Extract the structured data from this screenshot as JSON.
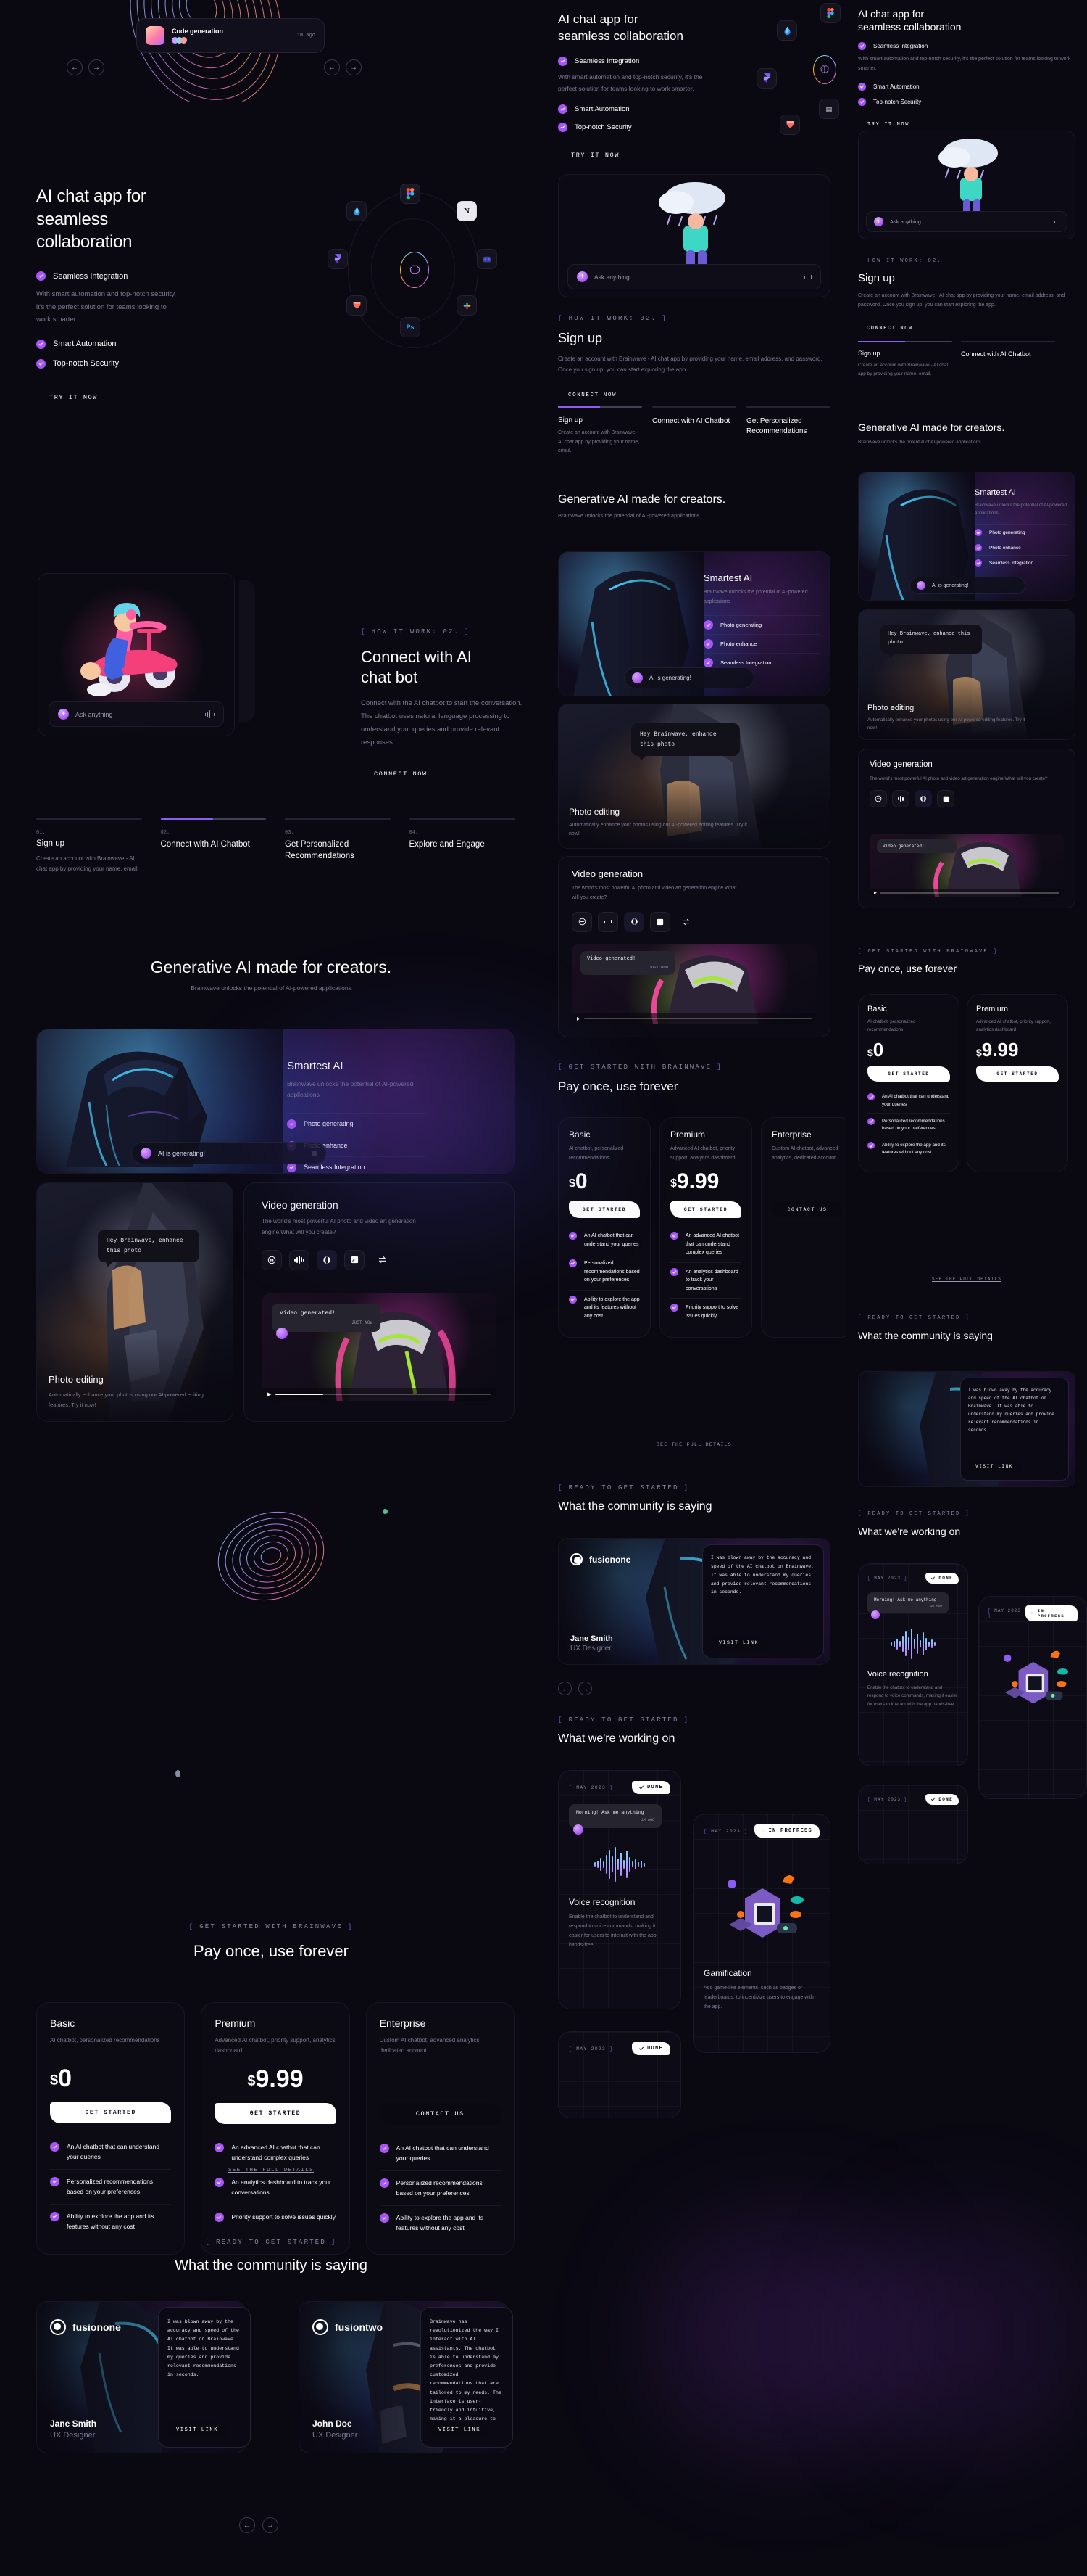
{
  "brand": {
    "name": "Brainwave"
  },
  "hero": {
    "title": "AI chat app for seamless collaboration",
    "title_line1": "AI chat app for",
    "title_line2": "seamless",
    "title_line3": "collaboration",
    "description": "With smart automation and top-notch security, it's the perfect solution for teams looking to work smarter.",
    "features": [
      "Seamless Integration",
      "Smart Automation",
      "Top-notch Security"
    ],
    "cta": "TRY IT NOW",
    "notification": {
      "title": "Code generation",
      "time": "1m ago"
    },
    "integration_icons": [
      "figma-icon",
      "notion-icon",
      "photoshop-icon",
      "slack-icon",
      "discord-icon",
      "framer-icon",
      "protopie-icon",
      "raindrop-icon",
      "brain-icon"
    ]
  },
  "howitwork": {
    "label": "HOW IT WORK: 02.",
    "title_line1": "Connect with AI",
    "title_line2": "chat bot",
    "description": "Connect with the AI chatbot to start the conversation. The chatbot uses natural language processing to understand your queries and provide relevant responses.",
    "cta": "CONNECT NOW",
    "chat_placeholder": "Ask anything"
  },
  "steps": [
    {
      "num": "01.",
      "label": "Sign up",
      "desc": "Create an account with Brainwave - AI chat app by providing your name, email.",
      "progress": 0
    },
    {
      "num": "02.",
      "label": "Connect with AI Chatbot",
      "desc": "",
      "progress": 50
    },
    {
      "num": "03.",
      "label": "Get Personalized Recommendations",
      "desc": "",
      "progress": 0
    },
    {
      "num": "04.",
      "label": "Explore and Engage",
      "desc": "",
      "progress": 0
    }
  ],
  "signup": {
    "title": "Sign up",
    "description": "Create an account with Brainwave - AI chat app by providing your name, email address, and password. Once you sign up, you can start exploring the app.",
    "cta": "CONNECT NOW"
  },
  "generative": {
    "title": "Generative AI made for creators.",
    "subtitle": "Brainwave unlocks the potential of AI-powered applications"
  },
  "smartest": {
    "title": "Smartest AI",
    "description": "Brainwave unlocks the potential of AI-powered applications",
    "features": [
      "Photo generating",
      "Photo enhance",
      "Seamless Integration"
    ],
    "status": "AI is generating!"
  },
  "photo_editing": {
    "title": "Photo editing",
    "description": "Automatically enhance your photos using our AI-powered editing features. Try it now!",
    "bubble": "Hey Brainwave, enhance this photo"
  },
  "video_generation": {
    "title": "Video generation",
    "description": "The world's most powerful AI photo and video art generation engine.What will you create?",
    "tools": [
      "voice-ball-icon",
      "audio-wave-icon",
      "sphere-icon",
      "document-icon",
      "transfer-icon"
    ],
    "active_tool_index": 2,
    "bubble": "Video generated!",
    "bubble_time": "JUST NOW"
  },
  "pricing": {
    "label": "GET STARTED WITH BRAINWAVE",
    "title": "Pay once, use forever",
    "details_link": "SEE THE FULL DETAILS",
    "plans": [
      {
        "name": "Basic",
        "description": "AI chatbot, personalized recommendations",
        "currency": "$",
        "price": "0",
        "cta": "GET STARTED",
        "cta_style": "white",
        "features": [
          "An AI chatbot that can understand your queries",
          "Personalized recommendations based on your preferences",
          "Ability to explore the app and its features without any cost"
        ]
      },
      {
        "name": "Premium",
        "description": "Advanced AI chatbot, priority support, analytics dashboard",
        "currency": "$",
        "price": "9.99",
        "cta": "GET STARTED",
        "cta_style": "white",
        "features": [
          "An advanced AI chatbot that can understand complex queries",
          "An analytics dashboard to track your conversations",
          "Priority support to solve issues quickly"
        ]
      },
      {
        "name": "Enterprise",
        "description": "Custom AI chatbot, advanced analytics, dedicated account",
        "currency": "",
        "price": "",
        "cta": "CONTACT US",
        "cta_style": "gradient",
        "features": [
          "An AI chatbot that can understand your queries",
          "Personalized recommendations based on your preferences",
          "Ability to explore the app and its features without any cost"
        ]
      }
    ]
  },
  "testimonials": {
    "label": "READY TO GET STARTED",
    "title": "What the community is saying",
    "cards": [
      {
        "logo": "fusionone",
        "name": "Jane Smith",
        "role": "UX Designer",
        "quote": "I was blown away by the accuracy and speed of the AI chatbot on Brainwave. It was able to understand my queries and provide relevant recommendations in seconds.",
        "cta": "VISIT LINK"
      },
      {
        "logo": "fusiontwo",
        "name": "John Doe",
        "role": "UX Designer",
        "quote": "Brainwave has revolutionized the way I interact with AI assistants. The chatbot is able to understand my preferences and provide customized recommendations that are tailored to my needs. The interface is user-friendly and intuitive, making it a pleasure to use.",
        "cta": "VISIT LINK"
      }
    ]
  },
  "roadmap": {
    "label": "READY TO GET STARTED",
    "title": "What we're working on",
    "cards": [
      {
        "date": "MAY 2023",
        "status": "DONE",
        "status_icon": "check-icon",
        "title": "Voice recognition",
        "description": "Enable the chatbot to understand and respond to voice commands, making it easier for users to interact with the app hands-free.",
        "bubble": "Morning! Ask me anything",
        "bubble_time": "1M AGO"
      },
      {
        "date": "MAY 2023",
        "status": "IN PROFRESS",
        "status_icon": "spinner-icon",
        "title": "Gamification",
        "description": "Add game-like elements, such as badges or leaderboards, to incentivize users to engage with the app.",
        "bubble": "",
        "bubble_time": ""
      },
      {
        "date": "MAY 2023",
        "status": "DONE",
        "status_icon": "check-icon",
        "title": "",
        "description": "",
        "bubble": "",
        "bubble_time": ""
      }
    ]
  },
  "nav": {
    "prev": "prev-arrow-icon",
    "next": "next-arrow-icon"
  },
  "colors": {
    "accent": "#a855f7",
    "bg": "#0a0912",
    "card": "#0c0b15",
    "text_muted": "#7d7a91",
    "gradient": "linear-gradient(90deg,#89f8d4,#c8a8ff,#f5a3c7,#f6c99a)"
  }
}
